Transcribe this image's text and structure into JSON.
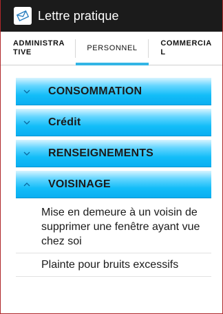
{
  "app": {
    "title": "Lettre pratique",
    "icon": "envelope-icon",
    "colors": {
      "actionbar": "#1b1b1b",
      "accent": "#33b5e5",
      "group_fill": "#13bdf8"
    }
  },
  "tabs": [
    {
      "label": "ADMINISTRATIVE",
      "selected": false
    },
    {
      "label": "PERSONNEL",
      "selected": true
    },
    {
      "label": "COMMERCIAL",
      "selected": false
    }
  ],
  "groups": [
    {
      "label": "CONSOMMATION",
      "expanded": false,
      "icon": "chevron-down-icon"
    },
    {
      "label": "Crédit",
      "expanded": false,
      "icon": "chevron-down-icon"
    },
    {
      "label": "RENSEIGNEMENTS",
      "expanded": false,
      "icon": "chevron-down-icon"
    },
    {
      "label": "VOISINAGE",
      "expanded": true,
      "icon": "chevron-up-icon"
    }
  ],
  "children": [
    {
      "label": "Mise en demeure à un voisin de supprimer une fenêtre ayant vue chez soi"
    },
    {
      "label": "Plainte pour bruits excessifs"
    }
  ]
}
